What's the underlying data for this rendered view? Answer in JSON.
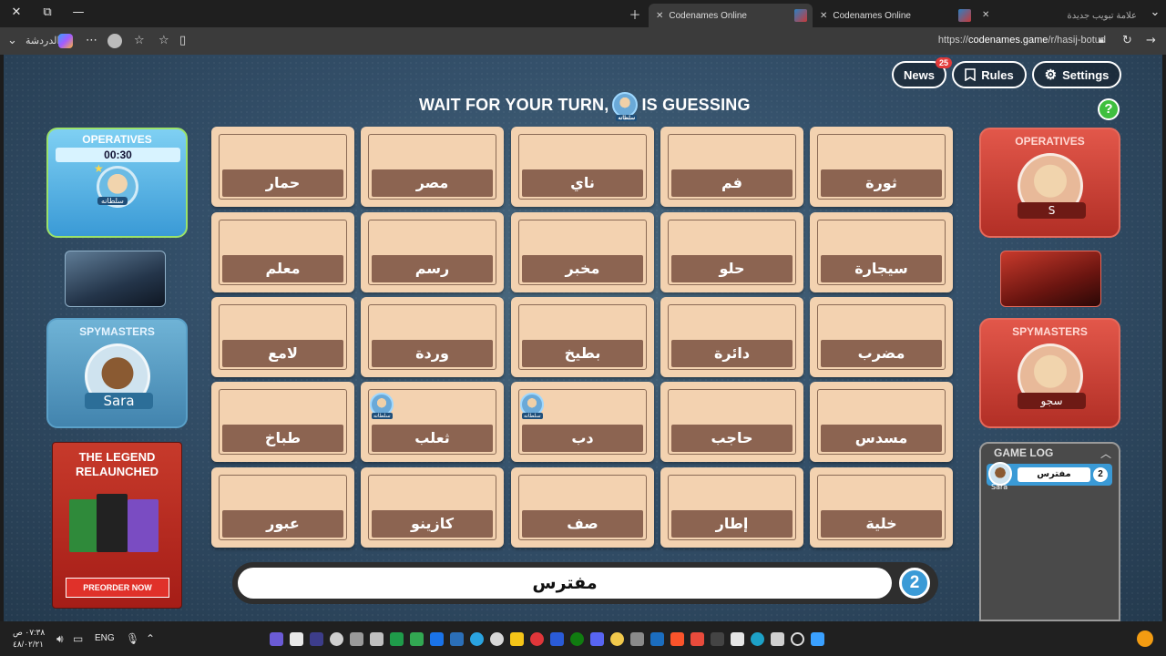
{
  "browser": {
    "tabs": [
      {
        "label": "Codenames Online",
        "active": true
      },
      {
        "label": "Codenames Online",
        "active": false
      },
      {
        "label": "علامة تبويب جديدة",
        "active": false
      }
    ],
    "url_prefix": "https://",
    "url_host": "codenames.game",
    "url_path": "/r/hasij-botud",
    "sidebar_chat_label": "الدردشة",
    "icons": [
      "close-icon",
      "restore-icon",
      "minimize-icon",
      "new-tab-icon",
      "back-icon",
      "refresh-icon",
      "lock-icon",
      "star-icon",
      "favorites-icon",
      "profile-icon",
      "more-icon",
      "chevron-down-icon"
    ]
  },
  "header": {
    "news_label": "News",
    "news_badge": "25",
    "rules_label": "Rules",
    "settings_label": "Settings",
    "help_label": "?",
    "headline_left": "WAIT FOR YOUR TURN,",
    "headline_right": "IS GUESSING",
    "headline_avatar_tag": "سلطانه"
  },
  "blue_team": {
    "operatives_title": "OPERATIVES",
    "timer": "00:30",
    "operative_name": "سلطانه",
    "spymasters_title": "SPYMASTERS",
    "spymaster_name": "Sara",
    "color": "#3a9ad6"
  },
  "red_team": {
    "operatives_title": "OPERATIVES",
    "operative_name": "S",
    "spymasters_title": "SPYMASTERS",
    "spymaster_name": "سجو",
    "color": "#c8392c"
  },
  "promo": {
    "line1": "THE LEGEND",
    "line2": "RELAUNCHED",
    "button": "PREORDER NOW"
  },
  "board": {
    "rows": [
      [
        {
          "word": "حمار"
        },
        {
          "word": "مصر"
        },
        {
          "word": "ناي"
        },
        {
          "word": "فم"
        },
        {
          "word": "ثورة"
        }
      ],
      [
        {
          "word": "معلم"
        },
        {
          "word": "رسم"
        },
        {
          "word": "مخبر"
        },
        {
          "word": "حلو"
        },
        {
          "word": "سيجارة"
        }
      ],
      [
        {
          "word": "لامع"
        },
        {
          "word": "وردة"
        },
        {
          "word": "بطيخ"
        },
        {
          "word": "دائرة"
        },
        {
          "word": "مضرب"
        }
      ],
      [
        {
          "word": "طباخ"
        },
        {
          "word": "ثعلب",
          "picked_by": "سلطانه"
        },
        {
          "word": "دب",
          "picked_by": "سلطانه"
        },
        {
          "word": "حاجب"
        },
        {
          "word": "مسدس"
        }
      ],
      [
        {
          "word": "عبور"
        },
        {
          "word": "كازينو"
        },
        {
          "word": "صف"
        },
        {
          "word": "إطار"
        },
        {
          "word": "خلية"
        }
      ]
    ]
  },
  "clue": {
    "word": "مفترس",
    "number": "2"
  },
  "game_log": {
    "title": "GAME LOG",
    "entries": [
      {
        "player": "Sara",
        "clue": "مفترس",
        "number": "2"
      }
    ]
  },
  "taskbar": {
    "time": "٠٧:٣٨ ص",
    "date": "٤٨/٠٢/٢١",
    "language": "ENG"
  }
}
